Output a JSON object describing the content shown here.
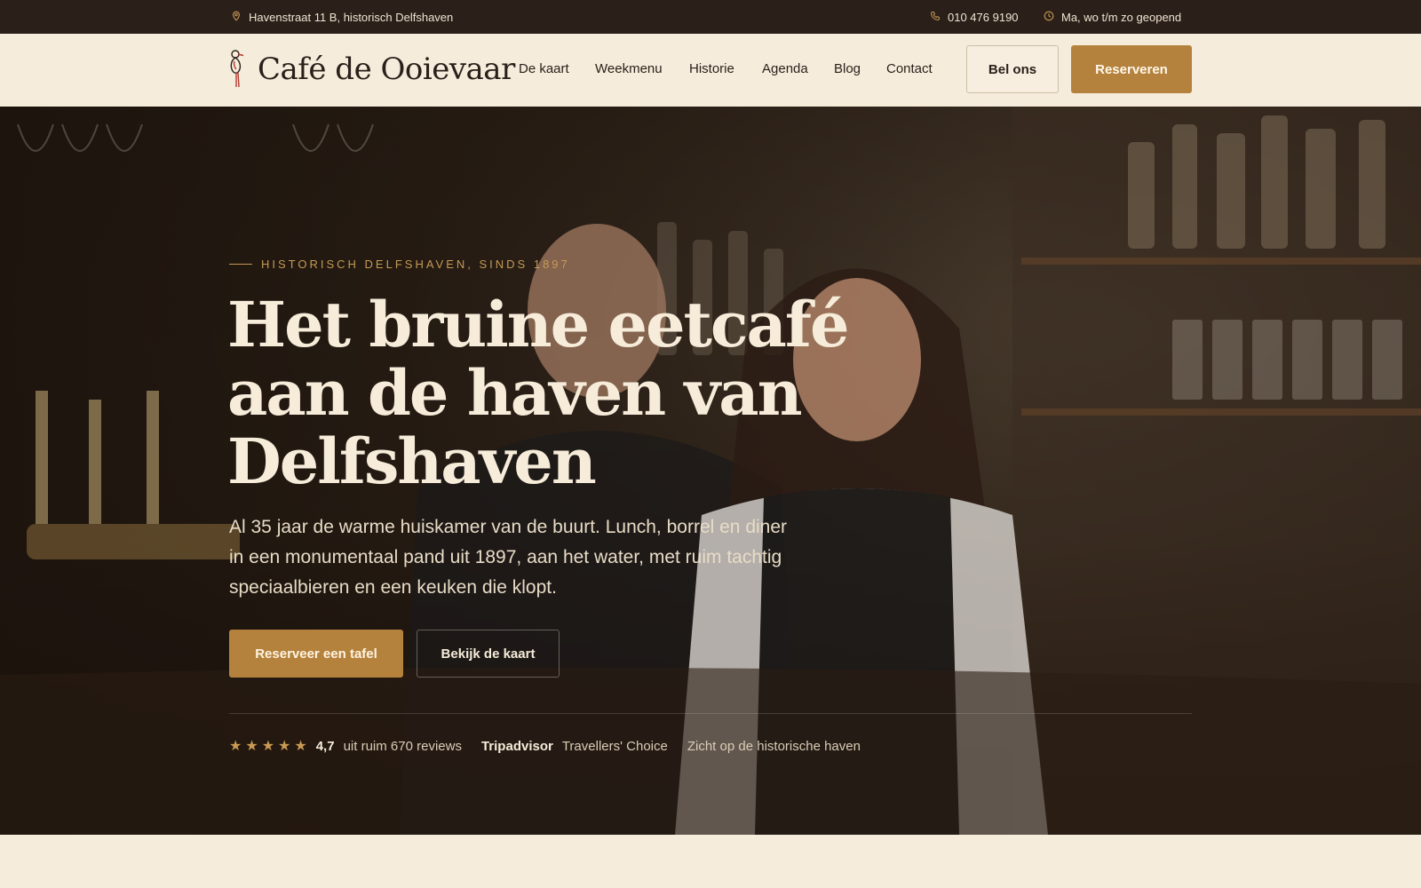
{
  "topbar": {
    "address": "Havenstraat 11 B, historisch Delfshaven",
    "phone": "010 476 9190",
    "hours": "Ma, wo t/m zo geopend"
  },
  "brand": {
    "name": "Café de Ooievaar"
  },
  "nav": {
    "items": [
      "De kaart",
      "Weekmenu",
      "Historie",
      "Agenda",
      "Blog",
      "Contact"
    ],
    "call_label": "Bel ons",
    "reserve_label": "Reserveren"
  },
  "hero": {
    "eyebrow": "HISTORISCH DELFSHAVEN, SINDS 1897",
    "title": "Het bruine eetcafé aan de haven van Delfshaven",
    "subtitle": "Al 35 jaar de warme huiskamer van de buurt. Lunch, borrel en diner in een monumentaal pand uit 1897, aan het water, met ruim tachtig speciaalbieren en een keuken die klopt.",
    "primary_cta": "Reserveer een tafel",
    "secondary_cta": "Bekijk de kaart"
  },
  "rating": {
    "stars": 5,
    "value": "4,7",
    "count_text": "uit ruim 670 reviews",
    "platform": "Tripadvisor",
    "award": "Travellers' Choice",
    "feature": "Zicht op de historische haven"
  },
  "colors": {
    "topbar_bg": "#2a1f19",
    "cream": "#f5ecdb",
    "gold": "#b5823e",
    "eyebrow": "#c59a55"
  },
  "icons": {
    "address": "location-pin-icon",
    "phone": "phone-icon",
    "hours": "clock-icon",
    "logo": "stork-icon",
    "star": "star-icon"
  }
}
